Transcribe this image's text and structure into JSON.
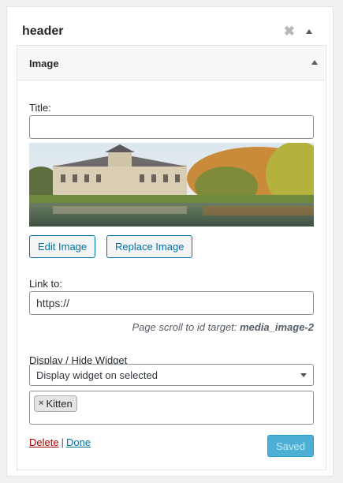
{
  "sidebar": {
    "title": "header",
    "close_icon": "close-icon",
    "toggle_icon": "caret-up-icon"
  },
  "widget": {
    "title": "Image",
    "title_field": {
      "label": "Title:",
      "value": ""
    },
    "image": {
      "description": "palace-with-lake-photo"
    },
    "buttons": {
      "edit": "Edit Image",
      "replace": "Replace Image"
    },
    "link_field": {
      "label": "Link to:",
      "value": "https://"
    },
    "scroll_note": {
      "prefix": "Page scroll to id target:",
      "target": "media_image-2"
    },
    "visibility": {
      "label": "Display / Hide Widget",
      "selected": "Display widget on selected",
      "tags": [
        "Kitten"
      ]
    },
    "footer": {
      "delete": "Delete",
      "separator": "|",
      "done": "Done",
      "saved": "Saved"
    }
  },
  "colors": {
    "accent": "#0071a1",
    "delete": "#a00000",
    "saved_bg": "#2ea2cc"
  }
}
